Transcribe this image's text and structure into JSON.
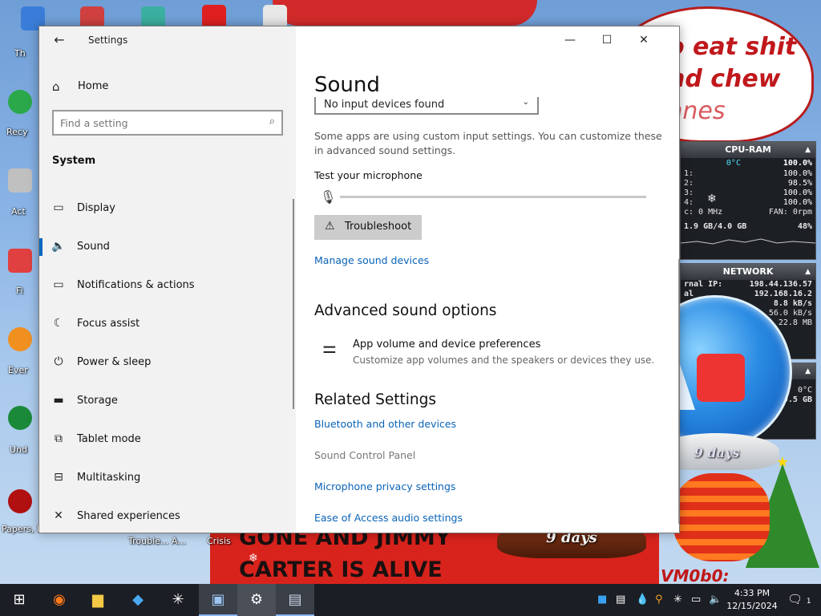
{
  "desktop": {
    "speech_lines": [
      "o eat shit",
      "nd chew",
      "anes"
    ],
    "banner_lines": [
      "GONE AND JIMMY",
      "CARTER IS ALIVE"
    ],
    "labels": [
      "Th",
      "Recy",
      "Act",
      "Fi",
      "Ever",
      "Und",
      "Papers, P",
      "Trouble... A...",
      "Crisis"
    ],
    "corner_text": "VM0b0:"
  },
  "gadgets": {
    "cpu": {
      "title": "CPU-RAM",
      "temp": "0°C",
      "total": "100.0%",
      "cores": [
        {
          "label": "1:",
          "value": "100.0%"
        },
        {
          "label": "2:",
          "value": "98.5%"
        },
        {
          "label": "3:",
          "value": "100.0%"
        },
        {
          "label": "4:",
          "value": "100.0%"
        }
      ],
      "freq": "c: 0 MHz",
      "fan": "FAN: 0rpm",
      "memory": "1.9 GB/4.0 GB",
      "memory_pct": "48%"
    },
    "network": {
      "title": "NETWORK",
      "rows": [
        {
          "label": "rnal IP:",
          "value": "198.44.136.57"
        },
        {
          "label": "al",
          "value": "192.168.16.2"
        },
        {
          "label": "",
          "value": "8.8 kB/s"
        },
        {
          "label": "",
          "value": "56.0 kB/s"
        },
        {
          "label": "",
          "value": "22.8 MB"
        }
      ]
    },
    "third": {
      "temp": "0°C",
      "size": "9.5 GB"
    }
  },
  "globes": {
    "big_days": "9 days",
    "small_days": "9 days"
  },
  "window": {
    "title": "Settings",
    "back_icon": "back-arrow-icon",
    "controls": {
      "minimize": "—",
      "maximize": "☐",
      "close": "✕"
    },
    "sidebar": {
      "home": "Home",
      "search_placeholder": "Find a setting",
      "section": "System",
      "items": [
        {
          "label": "Display",
          "icon": "display-icon",
          "glyph": "▭"
        },
        {
          "label": "Sound",
          "icon": "speaker-icon",
          "glyph": "🔈"
        },
        {
          "label": "Notifications & actions",
          "icon": "notification-icon",
          "glyph": "▭"
        },
        {
          "label": "Focus assist",
          "icon": "moon-icon",
          "glyph": "☾"
        },
        {
          "label": "Power & sleep",
          "icon": "power-icon",
          "glyph": "⏻"
        },
        {
          "label": "Storage",
          "icon": "storage-icon",
          "glyph": "▬"
        },
        {
          "label": "Tablet mode",
          "icon": "tablet-icon",
          "glyph": "⧉"
        },
        {
          "label": "Multitasking",
          "icon": "multitasking-icon",
          "glyph": "⊟"
        },
        {
          "label": "Shared experiences",
          "icon": "shared-icon",
          "glyph": "✕"
        }
      ],
      "active_index": 1
    },
    "main": {
      "title": "Sound",
      "input_device": "No input devices found",
      "custom_note": "Some apps are using custom input settings. You can customize these in advanced sound settings.",
      "test_label": "Test your microphone",
      "mic_level": 0,
      "troubleshoot": "Troubleshoot",
      "manage_link": "Manage sound devices",
      "advanced_heading": "Advanced sound options",
      "pref_title": "App volume and device preferences",
      "pref_sub": "Customize app volumes and the speakers or devices they use.",
      "related_heading": "Related Settings",
      "related_links": [
        {
          "label": "Bluetooth and other devices",
          "style": "link"
        },
        {
          "label": "Sound Control Panel",
          "style": "gray"
        },
        {
          "label": "Microphone privacy settings",
          "style": "link"
        },
        {
          "label": "Ease of Access audio settings",
          "style": "link"
        }
      ]
    }
  },
  "taskbar": {
    "apps": [
      {
        "name": "start-icon",
        "glyph": "⊞"
      },
      {
        "name": "firefox-icon",
        "glyph": "◉"
      },
      {
        "name": "file-explorer-icon",
        "glyph": "▆"
      },
      {
        "name": "app-icon",
        "glyph": "◆"
      },
      {
        "name": "sparkle-icon",
        "glyph": "✳"
      },
      {
        "name": "image-app-icon",
        "glyph": "▣"
      },
      {
        "name": "settings-icon",
        "glyph": "⚙"
      },
      {
        "name": "document-app-icon",
        "glyph": "▤"
      }
    ],
    "time": "4:33 PM",
    "date": "12/15/2024",
    "notification_count": "1"
  },
  "colors": {
    "accent": "#0067c0",
    "link": "#0a63b8",
    "taskbar": "#1b1e24",
    "banner": "#d8231d"
  }
}
